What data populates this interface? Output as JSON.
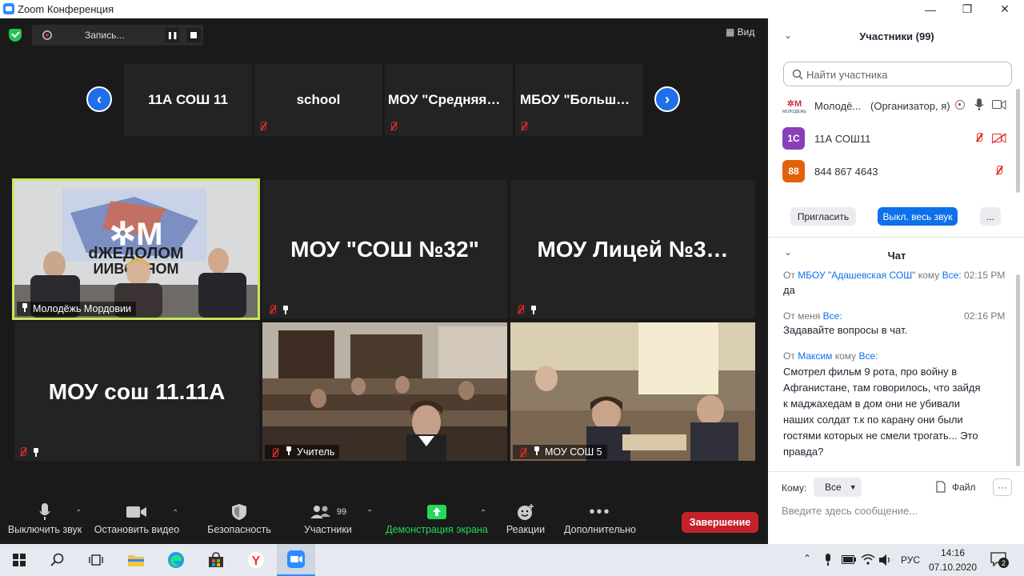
{
  "window": {
    "title": "Zoom Конференция",
    "minimize": "—",
    "maximize": "❐",
    "close": "✕"
  },
  "topbar": {
    "record_label": "Запись...",
    "view_label": "Вид"
  },
  "thumbstrip": {
    "items": [
      "11А СОШ 11",
      "school",
      "МОУ  \"Средняя…",
      "МБОУ  \"Больш…"
    ]
  },
  "tiles": [
    {
      "big": "",
      "name": "Молодёжь Мордовии"
    },
    {
      "big": "МОУ \"СОШ №32\"",
      "name": ""
    },
    {
      "big": "МОУ Лицей №3…",
      "name": ""
    },
    {
      "big": "МОУ сош 11.11А",
      "name": ""
    },
    {
      "big": "",
      "name": "Учитель"
    },
    {
      "big": "",
      "name": "МОУ СОШ 5"
    }
  ],
  "toolbar": {
    "mute": "Выключить звук",
    "video": "Остановить видео",
    "security": "Безопасность",
    "participants": "Участники",
    "participants_count": "99",
    "share": "Демонстрация экрана",
    "reactions": "Реакции",
    "more": "Дополнительно",
    "end": "Завершение"
  },
  "participants": {
    "title": "Участники (99)",
    "search_placeholder": "Найти участника",
    "rows": [
      {
        "avatar": "",
        "name": "Молодё...",
        "role": "(Организатор, я)",
        "color": "#ffffff"
      },
      {
        "avatar": "1С",
        "name": "11А СОШ11",
        "role": "",
        "color": "#8a3fb8"
      },
      {
        "avatar": "88",
        "name": "844 867 4643",
        "role": "",
        "color": "#e36209"
      }
    ],
    "invite": "Пригласить",
    "mute_all": "Выкл. весь звук",
    "more": "..."
  },
  "chat": {
    "title": "Чат",
    "messages": [
      {
        "from_prefix": "От",
        "from": "МБОУ \"Адашевская СОШ\"",
        "to_prefix": "кому",
        "to": "Все:",
        "time": "02:15 PM",
        "text": "да"
      },
      {
        "from_prefix": "От",
        "from": "меня",
        "to_prefix": "",
        "to": "Все:",
        "time": "02:16 PM",
        "text": "Задавайте вопросы в чат."
      },
      {
        "from_prefix": "От",
        "from": "Максим",
        "to_prefix": "кому",
        "to": "Все:",
        "time": "",
        "text": "Смотрел фильм 9 рота, про войну в Афганистане, там говорилось, что зайдя к маджахедам в дом они не убивали наших солдат т.к по карану они были гостями которых не смели трогать... Это правда?"
      }
    ],
    "to_label": "Кому:",
    "to_value": "Все",
    "file_label": "Файл",
    "more": "···",
    "input_placeholder": "Введите здесь сообщение..."
  },
  "taskbar": {
    "lang": "РУС",
    "time": "14:16",
    "date": "07.10.2020",
    "notif": "2"
  }
}
